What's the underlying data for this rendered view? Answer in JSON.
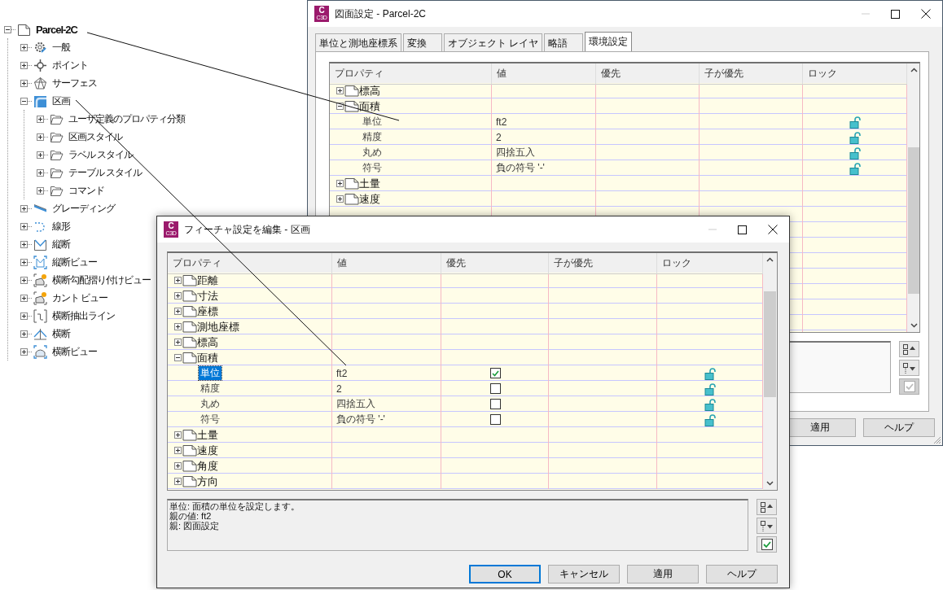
{
  "tree": {
    "label": "Parcel-2C",
    "expanded": true,
    "children": [
      {
        "label": "一般",
        "expanded": false
      },
      {
        "label": "ポイント",
        "expanded": false
      },
      {
        "label": "サーフェス",
        "expanded": false
      },
      {
        "label": "区画",
        "expanded": true,
        "children": [
          {
            "label": "ユーザ定義のプロパティ分類",
            "expanded": false
          },
          {
            "label": "区画スタイル",
            "expanded": false
          },
          {
            "label": "ラベル スタイル",
            "expanded": false
          },
          {
            "label": "テーブル スタイル",
            "expanded": false
          },
          {
            "label": "コマンド",
            "expanded": false
          }
        ]
      },
      {
        "label": "グレーディング",
        "expanded": false
      },
      {
        "label": "線形",
        "expanded": false
      },
      {
        "label": "縦断",
        "expanded": false
      },
      {
        "label": "縦断ビュー",
        "expanded": false
      },
      {
        "label": "横断勾配摺り付けビュー",
        "expanded": false
      },
      {
        "label": "カント ビュー",
        "expanded": false
      },
      {
        "label": "横断抽出ライン",
        "expanded": false
      },
      {
        "label": "横断",
        "expanded": false
      },
      {
        "label": "横断ビュー",
        "expanded": false
      }
    ]
  },
  "drawing_settings": {
    "title": "図面設定 - Parcel-2C",
    "app_icon": {
      "letter": "C",
      "sublabel": "C3D"
    },
    "tabs": [
      {
        "label": "単位と測地座標系",
        "selected": false
      },
      {
        "label": "変換",
        "selected": false
      },
      {
        "label": "オブジェクト レイヤ",
        "selected": false
      },
      {
        "label": "略語",
        "selected": false
      },
      {
        "label": "環境設定",
        "selected": true
      }
    ],
    "columns": [
      "プロパティ",
      "値",
      "優先",
      "子が優先",
      "ロック"
    ],
    "rows": [
      {
        "kind": "group",
        "label": "標高",
        "expanded": false,
        "selected": false
      },
      {
        "kind": "group",
        "label": "面積",
        "expanded": true,
        "selected": false
      },
      {
        "kind": "property",
        "label": "単位",
        "value": "ft2",
        "locked": false,
        "selected": false
      },
      {
        "kind": "property",
        "label": "精度",
        "value": "2",
        "locked": false,
        "selected": false
      },
      {
        "kind": "property",
        "label": "丸め",
        "value": "四捨五入",
        "locked": false,
        "selected": false
      },
      {
        "kind": "property",
        "label": "符号",
        "value": "負の符号 '-'",
        "locked": false,
        "selected": false
      },
      {
        "kind": "group",
        "label": "土量",
        "expanded": false,
        "selected": false
      },
      {
        "kind": "group",
        "label": "速度",
        "expanded": false,
        "selected": false
      }
    ],
    "tool_buttons": [
      {
        "kind": "expand",
        "disabled": false
      },
      {
        "kind": "collapse",
        "disabled": false
      },
      {
        "kind": "check",
        "disabled": true
      }
    ],
    "buttons": [
      {
        "label": "適用",
        "default": false
      },
      {
        "label": "ヘルプ",
        "default": false
      }
    ]
  },
  "feature_settings": {
    "title": "フィーチャ設定を編集 - 区画",
    "app_icon": {
      "letter": "C",
      "sublabel": "C3D"
    },
    "columns": [
      "プロパティ",
      "値",
      "優先",
      "子が優先",
      "ロック"
    ],
    "rows": [
      {
        "kind": "group",
        "label": "距離",
        "expanded": false,
        "selected": false
      },
      {
        "kind": "group",
        "label": "寸法",
        "expanded": false,
        "selected": false
      },
      {
        "kind": "group",
        "label": "座標",
        "expanded": false,
        "selected": false
      },
      {
        "kind": "group",
        "label": "測地座標",
        "expanded": false,
        "selected": false
      },
      {
        "kind": "group",
        "label": "標高",
        "expanded": false,
        "selected": false
      },
      {
        "kind": "group",
        "label": "面積",
        "expanded": true,
        "selected": false
      },
      {
        "kind": "property",
        "label": "単位",
        "value": "ft2",
        "override": true,
        "locked": false,
        "selected": true
      },
      {
        "kind": "property",
        "label": "精度",
        "value": "2",
        "override": false,
        "locked": false,
        "selected": false
      },
      {
        "kind": "property",
        "label": "丸め",
        "value": "四捨五入",
        "override": false,
        "locked": false,
        "selected": false
      },
      {
        "kind": "property",
        "label": "符号",
        "value": "負の符号 '-'",
        "override": false,
        "locked": false,
        "selected": false
      },
      {
        "kind": "group",
        "label": "土量",
        "expanded": false,
        "selected": false
      },
      {
        "kind": "group",
        "label": "速度",
        "expanded": false,
        "selected": false
      },
      {
        "kind": "group",
        "label": "角度",
        "expanded": false,
        "selected": false
      },
      {
        "kind": "group",
        "label": "方向",
        "expanded": false,
        "selected": false
      }
    ],
    "description": [
      "単位: 面積の単位を設定します。",
      "親の値: ft2",
      "親: 図面設定"
    ],
    "tool_buttons": [
      {
        "kind": "expand",
        "disabled": false
      },
      {
        "kind": "collapse",
        "disabled": false
      },
      {
        "kind": "check",
        "disabled": false
      }
    ],
    "buttons": [
      {
        "label": "OK",
        "default": true
      },
      {
        "label": "キャンセル",
        "default": false
      },
      {
        "label": "適用",
        "default": false
      },
      {
        "label": "ヘルプ",
        "default": false
      }
    ]
  }
}
